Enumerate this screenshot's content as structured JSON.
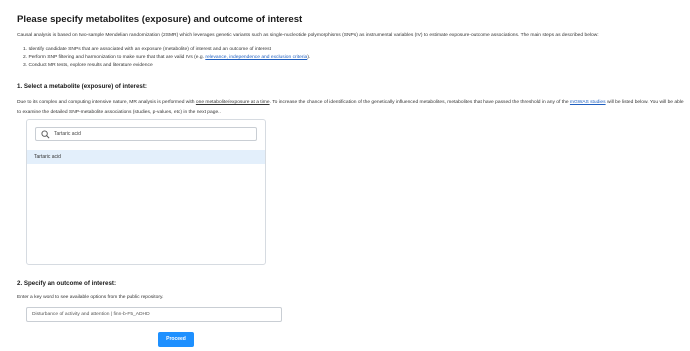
{
  "page": {
    "title": "Please specify metabolites (exposure) and outcome of interest",
    "intro": "Causal analysis is based on two-sample Mendelian randomization (2SMR) which leverages genetic variants such as single-nucleotide polymorphisms (SNPs) as instrumental variables (IV) to estimate exposure-outcome associations. The main steps as described below:",
    "steps": [
      {
        "text": "1. Identify candidate SNPs that are associated with an exposure (metabolite) of interest and an outcome of interest"
      },
      {
        "pre": "2. Perform SNP filtering and harmonization to make sure that that are valid IVs (e.g. ",
        "link": "relevance, independence and exclusion criteria",
        "post": ")."
      },
      {
        "text": "3. Conduct MR tests, explore results and literature evidence"
      }
    ]
  },
  "section1": {
    "heading": "1. Select a metabolite (exposure) of interest:",
    "desc_pre": "Due to its complex and computing intensive nature, MR analysis is performed with ",
    "desc_underline": "one metabolite/exposure at a time",
    "desc_mid": ". To increase the chance of identification of the genetically influenced metabolites, metabolites that have passed the threshold in any of the ",
    "desc_link": "mGWAS studies",
    "desc_post": " will be listed below. You will be able to examine the detailed SNP-metabolite associations (studies, p-values, etc) in the next page..",
    "search_value": "Tartaric acid",
    "option": "Tartaric acid"
  },
  "section2": {
    "heading": "2. Specify an outcome of interest:",
    "desc": "Enter a key word to see available options from the public repository.",
    "outcome_value": "Disturbance of activity and attention | finn-b-F5_ADHD"
  },
  "proceed_label": "Proceed",
  "colors": {
    "accent": "#1e90ff",
    "link": "#1f5fbf",
    "selected": "#e3effb"
  }
}
